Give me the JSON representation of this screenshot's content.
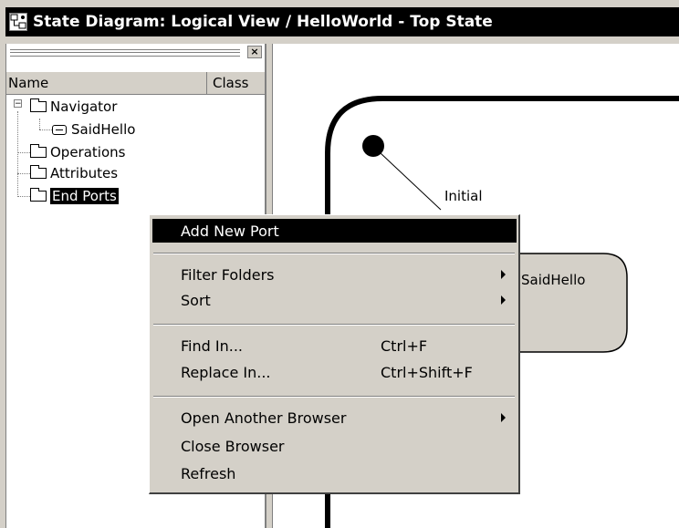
{
  "window": {
    "title": "State Diagram: Logical View / HelloWorld - Top State"
  },
  "browser": {
    "close_glyph": "×",
    "columns": {
      "name": "Name",
      "class": "Class"
    },
    "tree": [
      {
        "label": "Navigator",
        "type": "folder",
        "expanded": true
      },
      {
        "label": "SaidHello",
        "type": "message"
      },
      {
        "label": "Operations",
        "type": "folder"
      },
      {
        "label": "Attributes",
        "type": "folder"
      },
      {
        "label": "End Ports",
        "type": "folder",
        "selected": true
      }
    ]
  },
  "diagram": {
    "initial_label": "Initial",
    "state_label": "SaidHello"
  },
  "context_menu": {
    "items": [
      {
        "label": "Add New Port",
        "highlighted": true
      },
      {
        "label": "Filter Folders",
        "submenu": true
      },
      {
        "label": "Sort",
        "submenu": true
      },
      {
        "label": "Find In...",
        "shortcut": "Ctrl+F"
      },
      {
        "label": "Replace In...",
        "shortcut": "Ctrl+Shift+F"
      },
      {
        "label": "Open Another Browser",
        "submenu": true
      },
      {
        "label": "Close Browser"
      },
      {
        "label": "Refresh"
      }
    ]
  }
}
